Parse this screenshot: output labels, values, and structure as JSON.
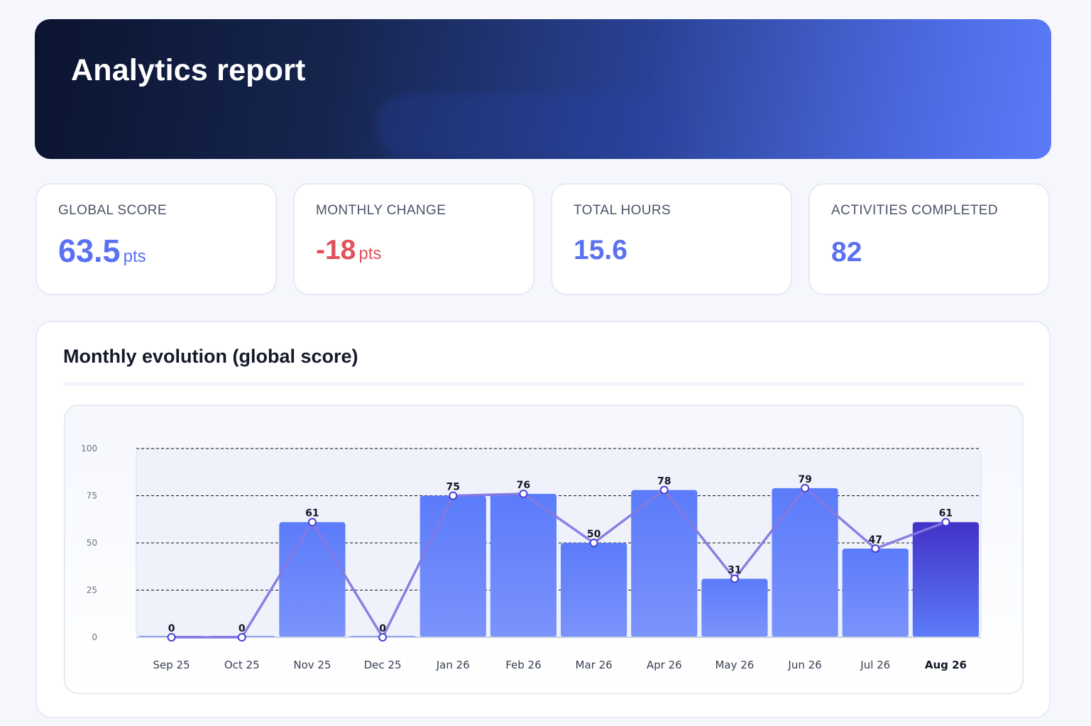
{
  "header": {
    "title": "Analytics report"
  },
  "kpis": [
    {
      "label": "GLOBAL SCORE",
      "value": "63.5",
      "unit": "pts",
      "color": "#5a72f2"
    },
    {
      "label": "MONTHLY CHANGE",
      "value": "-18",
      "unit": "pts",
      "color": "#e0525b"
    },
    {
      "label": "TOTAL HOURS",
      "value": "15.6",
      "unit": "",
      "color": "#5a72f2"
    },
    {
      "label": "ACTIVITIES COMPLETED",
      "value": "82",
      "unit": "",
      "color": "#5a72f2"
    }
  ],
  "panel": {
    "title": "Monthly evolution (global score)"
  },
  "chart_data": {
    "type": "bar",
    "categories": [
      "Sep 25",
      "Oct 25",
      "Nov 25",
      "Dec 25",
      "Jan 26",
      "Feb 26",
      "Mar 26",
      "Apr 26",
      "May 26",
      "Jun 26",
      "Jul 26",
      "Aug 26"
    ],
    "values": [
      0,
      0,
      61,
      0,
      75,
      76,
      50,
      78,
      31,
      79,
      47,
      61
    ],
    "overlay_line": true,
    "highlight_category": "Aug 26",
    "ylim": [
      0,
      100
    ],
    "yticks": [
      0,
      25,
      50,
      75,
      100
    ],
    "grid": "dashed horizontal",
    "title": "",
    "xlabel": "",
    "ylabel": "",
    "colors": {
      "bar": "#5b7bfa",
      "bar_light": "#7b93fb",
      "highlight_bar": "#4232c8",
      "line": "#8479e0",
      "point_stroke": "#4b3fd0"
    }
  }
}
